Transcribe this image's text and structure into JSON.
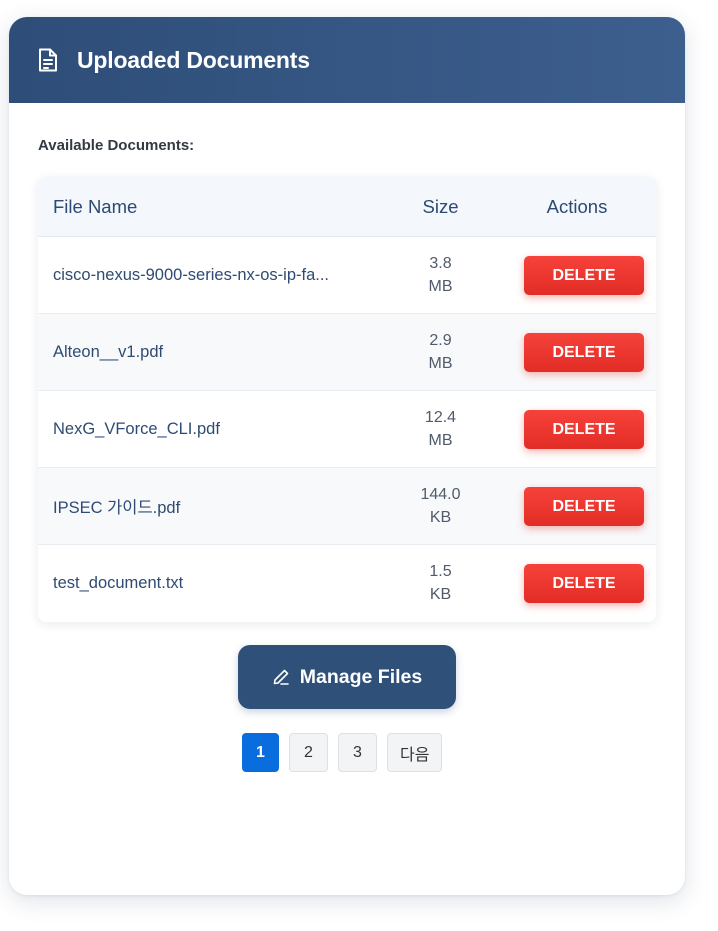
{
  "header": {
    "title": "Uploaded Documents",
    "icon": "document-icon"
  },
  "section_label": "Available Documents:",
  "table": {
    "columns": [
      "File Name",
      "Size",
      "Actions"
    ],
    "rows": [
      {
        "name": "cisco-nexus-9000-series-nx-os-ip-fa...",
        "size_value": "3.8",
        "size_unit": "MB",
        "action": "DELETE"
      },
      {
        "name": "Alteon__v1.pdf",
        "size_value": "2.9",
        "size_unit": "MB",
        "action": "DELETE"
      },
      {
        "name": "NexG_VForce_CLI.pdf",
        "size_value": "12.4",
        "size_unit": "MB",
        "action": "DELETE"
      },
      {
        "name": "IPSEC 가이드.pdf",
        "size_value": "144.0",
        "size_unit": "KB",
        "action": "DELETE"
      },
      {
        "name": "test_document.txt",
        "size_value": "1.5",
        "size_unit": "KB",
        "action": "DELETE"
      }
    ]
  },
  "manage_button": {
    "label": "Manage Files",
    "icon": "pencil-icon"
  },
  "pagination": {
    "pages": [
      "1",
      "2",
      "3"
    ],
    "active": "1",
    "next_label": "다음"
  },
  "colors": {
    "header": "#2e4d78",
    "delete": "#e22d26",
    "manage": "#2f5078",
    "active_page": "#0a6ddd"
  }
}
